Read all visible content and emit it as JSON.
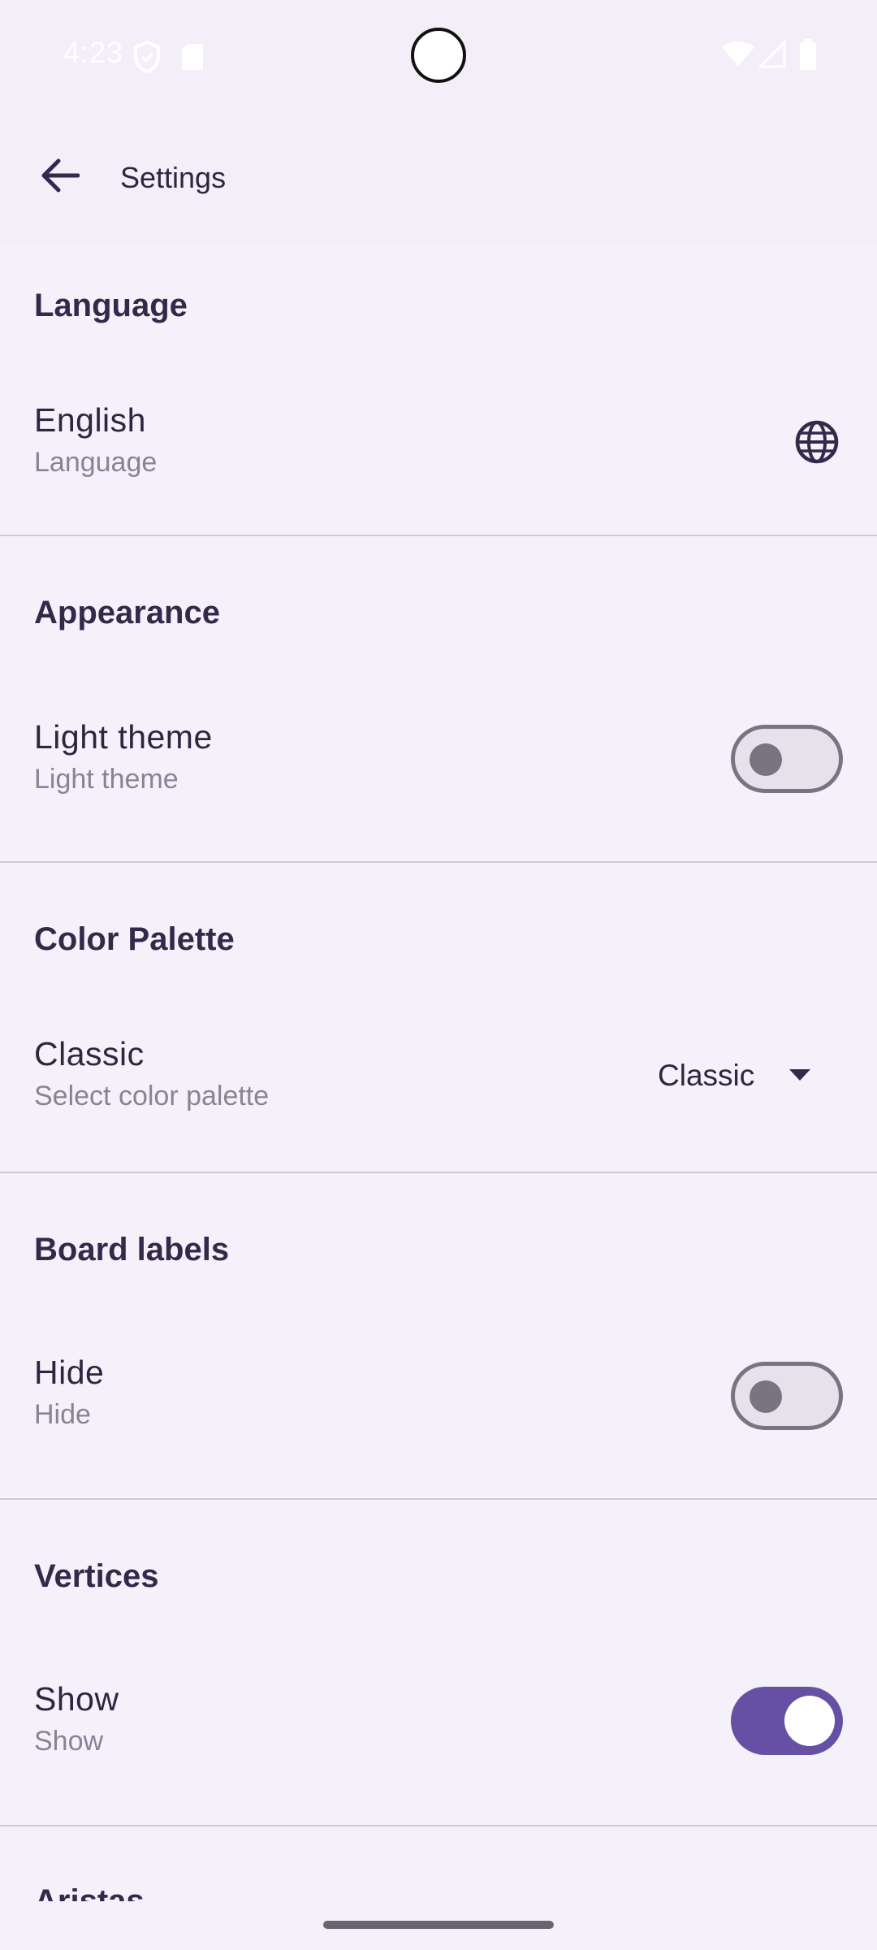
{
  "status_bar": {
    "time": "4:23",
    "icons": [
      "shield-icon",
      "sd-card-icon",
      "wifi-icon",
      "signal-icon",
      "battery-icon"
    ]
  },
  "app_bar": {
    "title": "Settings",
    "back_icon": "arrow-back-icon"
  },
  "sections": {
    "language": {
      "header": "Language",
      "item_title": "English",
      "item_subtitle": "Language",
      "icon": "globe-icon"
    },
    "appearance": {
      "header": "Appearance",
      "item_title": "Light theme",
      "item_subtitle": "Light theme",
      "toggle_on": false
    },
    "color_palette": {
      "header": "Color Palette",
      "item_title": "Classic",
      "item_subtitle": "Select color palette",
      "selected_value": "Classic"
    },
    "board_labels": {
      "header": "Board labels",
      "item_title": "Hide",
      "item_subtitle": "Hide",
      "toggle_on": false
    },
    "vertices": {
      "header": "Vertices",
      "item_title": "Show",
      "item_subtitle": "Show",
      "toggle_on": true
    },
    "next": {
      "header": "Aristas"
    }
  },
  "colors": {
    "accent": "#6650a4",
    "background": "#f5f1fa",
    "appbar": "#f3eef8"
  }
}
